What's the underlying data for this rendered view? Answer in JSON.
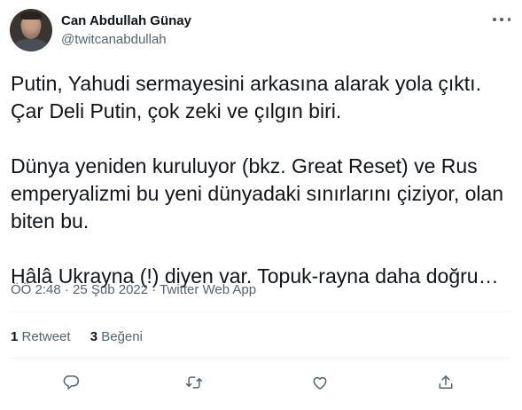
{
  "user": {
    "display_name": "Can Abdullah Günay",
    "handle": "@twitcanabdullah"
  },
  "tweet": {
    "text": "Putin, Yahudi sermayesini arkasına alarak yola çıktı.\nÇar Deli Putin, çok zeki ve çılgın biri.\n\nDünya yeniden kuruluyor (bkz. Great Reset) ve Rus emperyalizmi bu yeni dünyadaki sınırlarını çiziyor, olan biten bu.\n\nHâlâ Ukrayna (!) diyen var. Topuk-rayna daha doğru…",
    "meta": "ÖÖ 2:48 · 25 Şub 2022 · Twitter Web App"
  },
  "stats": {
    "retweet_count": "1",
    "retweet_label": "Retweet",
    "like_count": "3",
    "like_label": "Beğeni"
  },
  "icons": {
    "more": "more-horizontal-icon",
    "reply": "reply-icon",
    "retweet": "retweet-icon",
    "like": "heart-icon",
    "share": "share-icon"
  },
  "colors": {
    "text_primary": "#0f1419",
    "text_secondary": "#536471",
    "divider": "#eff3f4"
  }
}
